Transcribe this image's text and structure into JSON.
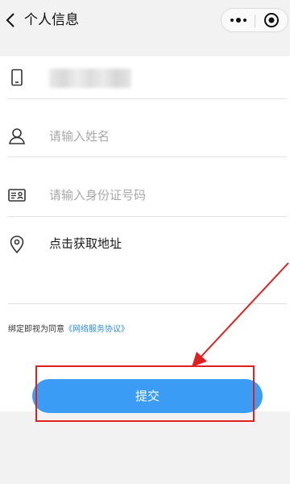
{
  "header": {
    "title": "个人信息",
    "back_icon": "chevron-left-icon",
    "more_icon": "more-dots-icon",
    "record_icon": "target-icon"
  },
  "form": {
    "phone_icon": "phone-icon",
    "name_icon": "user-icon",
    "name_placeholder": "请输入姓名",
    "id_icon": "id-card-icon",
    "id_placeholder": "请输入身份证号码",
    "address_icon": "location-pin-icon",
    "address_label": "点击获取地址"
  },
  "agreement": {
    "prefix": "绑定即视为同意",
    "link": "《网络服务协议》"
  },
  "submit": {
    "label": "提交"
  },
  "colors": {
    "accent": "#3b9cf5",
    "link": "#2f8cdd",
    "annotation_red": "#e21f1f",
    "page_bg": "#f2f2f2"
  }
}
